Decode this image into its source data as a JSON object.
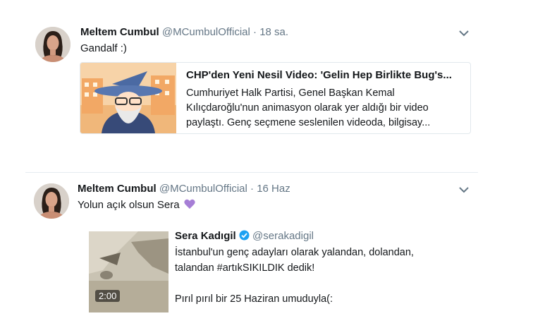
{
  "tweets": [
    {
      "name": "Meltem Cumbul",
      "handle": "@MCumbulOfficial",
      "separator": "·",
      "time": "18 sa.",
      "text": "Gandalf :)",
      "card": {
        "title": "CHP'den Yeni Nesil Video: 'Gelin Hep Birlikte Bug's...",
        "desc_lines": [
          "Cumhuriyet Halk Partisi, Genel Başkan Kemal",
          "Kılıçdaroğlu'nun animasyon olarak yer aldığı bir video",
          "paylaştı. Genç seçmene seslenilen videoda, bilgisay..."
        ]
      }
    },
    {
      "name": "Meltem Cumbul",
      "handle": "@MCumbulOfficial",
      "separator": "·",
      "time": "16 Haz",
      "text": "Yolun açık olsun Sera",
      "emoji": "💜",
      "quote": {
        "name": "Sera Kadıgil",
        "handle": "@serakadigil",
        "duration": "2:00",
        "lines": [
          "İstanbul'un genç adayları olarak yalandan, dolandan,",
          "talandan #artıkSIKILDIK dedik!",
          "",
          "Pırıl pırıl bir 25 Haziran umuduyla(:"
        ]
      }
    }
  ],
  "icons": {
    "caret": "chevron-down-icon",
    "verified": "verified-badge-icon",
    "heart": "purple-heart-icon"
  },
  "colors": {
    "verified": "#1da1f2",
    "muted": "#657786",
    "heart": "#a67ed6"
  }
}
